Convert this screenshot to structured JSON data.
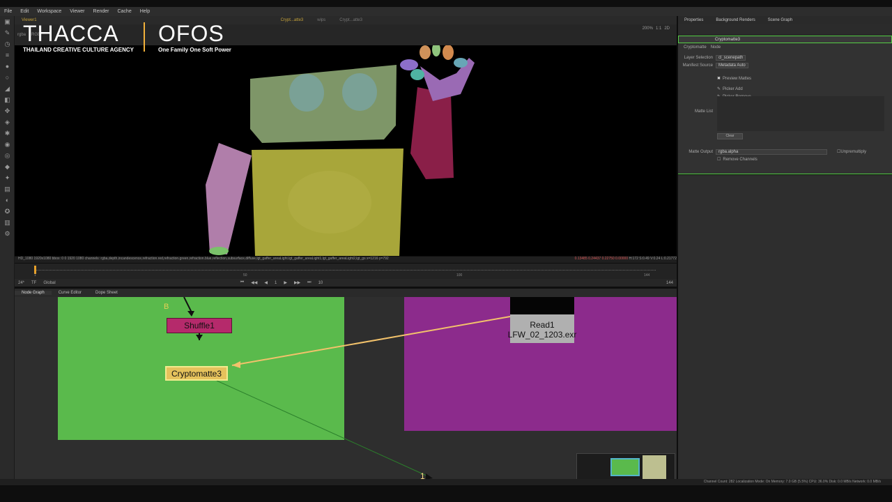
{
  "menu": [
    "File",
    "Edit",
    "Workspace",
    "Viewer",
    "Render",
    "Cache",
    "Help"
  ],
  "viewer_tabs": [
    "Viewer1",
    "Crypt...atte3",
    "wips",
    "Crypt...atte3"
  ],
  "viewer_controls": {
    "channels": "rgba",
    "channel_b": "RGB",
    "zoom": "200%",
    "ratio": "1:1",
    "mode": "2D"
  },
  "viewer_info": {
    "format": "HD_1080 1920x1080  bbox: 0 0 1920 1080 channels: rgba,depth,incandescence,refraction.red,refraction.green,refraction.blue,reflection,subsurface,diffuse,lgt_gaffer_areaLight.lgt_gaffer_areaLight1,lgt_gaffer_areaLight2,lgt_gs  x=1216 y=792",
    "pixel_values": "0.13485  0.24437  0.22750  0.00000",
    "hsv": "H:172 S:0.49 V:0.24  L:0.21772"
  },
  "timeline": {
    "start": "1",
    "mid1": "50",
    "mid2": "100",
    "end": "144",
    "fps": "24*",
    "tf": "TF",
    "scope": "Global",
    "frame": "1",
    "step": "10",
    "end_frame": "144"
  },
  "graph_tabs": [
    "Node Graph",
    "Curve Editor",
    "Dope Sheet"
  ],
  "nodes": {
    "shuffle": "Shuffle1",
    "crypto": "Cryptomatte3",
    "read_name": "Read1",
    "read_file": "LFW_02_1203.exr",
    "input_label": "B",
    "dot_label": "1"
  },
  "colors": {
    "backdrop_green": "#5aba4c",
    "backdrop_purple": "#8c2b8c",
    "connection": "#f3c26b",
    "accent": "#56d147"
  },
  "props_tabs": [
    "Properties",
    "Background Renders",
    "Scene Graph"
  ],
  "props": {
    "node_name": "Cryptomatte3",
    "tab_cryptomatte": "Cryptomatte",
    "tab_node": "Node",
    "layer_selection_label": "Layer Selection",
    "layer_selection_value": "cl_scenepath",
    "manifest_source_label": "Manifest Source",
    "manifest_source_value": "Metadata Auto",
    "preview_mattes": "Preview Mattes",
    "matte_list_label": "Matte List",
    "picker_add": "Picker Add",
    "picker_remove": "Picker Remove",
    "clear": "Clear",
    "matte_output_label": "Matte Output",
    "matte_output_value": "rgba.alpha",
    "unpremultiply": "Unpremultiply",
    "remove_channels": "Remove Channels"
  },
  "status": "Channel Count: 282  Localization Mode: On  Memory: 7.0 GB (5.5%)  CPU: 36.0%  Disk: 0.0 MB/s  Network: 0.0 MB/s",
  "watermark": {
    "left_title": "THACCA",
    "left_sub": "THAILAND CREATIVE CULTURE AGENCY",
    "right_title": "OFOS",
    "right_sub": "One Family One Soft Power"
  }
}
